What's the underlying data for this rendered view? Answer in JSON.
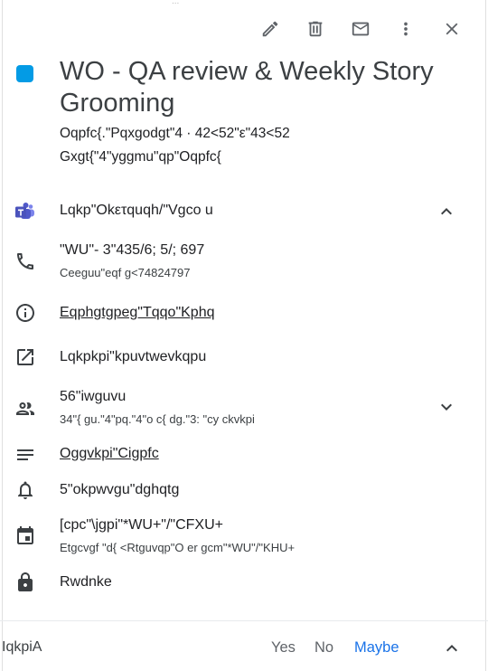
{
  "top_stub": "...",
  "toolbar": {
    "edit_icon": "pencil-icon",
    "delete_icon": "trash-icon",
    "email_icon": "envelope-icon",
    "more_icon": "more-vert-icon",
    "close_icon": "close-icon"
  },
  "event": {
    "color": "#039be5",
    "title": "WO - QA review & Weekly Story Grooming",
    "date_line": "Oqpfc{.\"Pqxgodgt\"4   ·   42<52\"ε\"43<52",
    "recurrence": "Gxgt{\"4\"yggmu\"qp\"Oqpfc{"
  },
  "teams": {
    "label": "Lqkp\"Okετquqh/\"Vgco u"
  },
  "phone": {
    "number": "\"WU\"- 3\"435/6; 5/; 697",
    "conference": "Ceeguu\"eqf g<74824797"
  },
  "info": {
    "label": "Eqphgtgpeg\"Tqqo\"Kphq"
  },
  "instructions": {
    "label": "Lqkpkpi\"kpuvtwevkqpu"
  },
  "guests": {
    "count": "56\"iwguvu",
    "summary": "34\"{ gu.\"4\"pq.\"4\"o c{ dg.\"3: \"cy ckvkpi"
  },
  "meeting_notes": {
    "label": "Oggvkpi\"Cigpfc"
  },
  "notification": {
    "label": "5\"okpwvgu\"dghqtg"
  },
  "calendar": {
    "owner": "[cpc\"\\jgpi\"*WU+\"/\"CFXU+",
    "creator": "Etgcvgf \"d{ <Rtguvqp\"O er gcm\"*WU\"/\"KHU+"
  },
  "visibility": {
    "label": "Rwdnke"
  },
  "footer": {
    "going": "IqkpiA",
    "yes": "Yes",
    "no": "No",
    "maybe": "Maybe"
  }
}
